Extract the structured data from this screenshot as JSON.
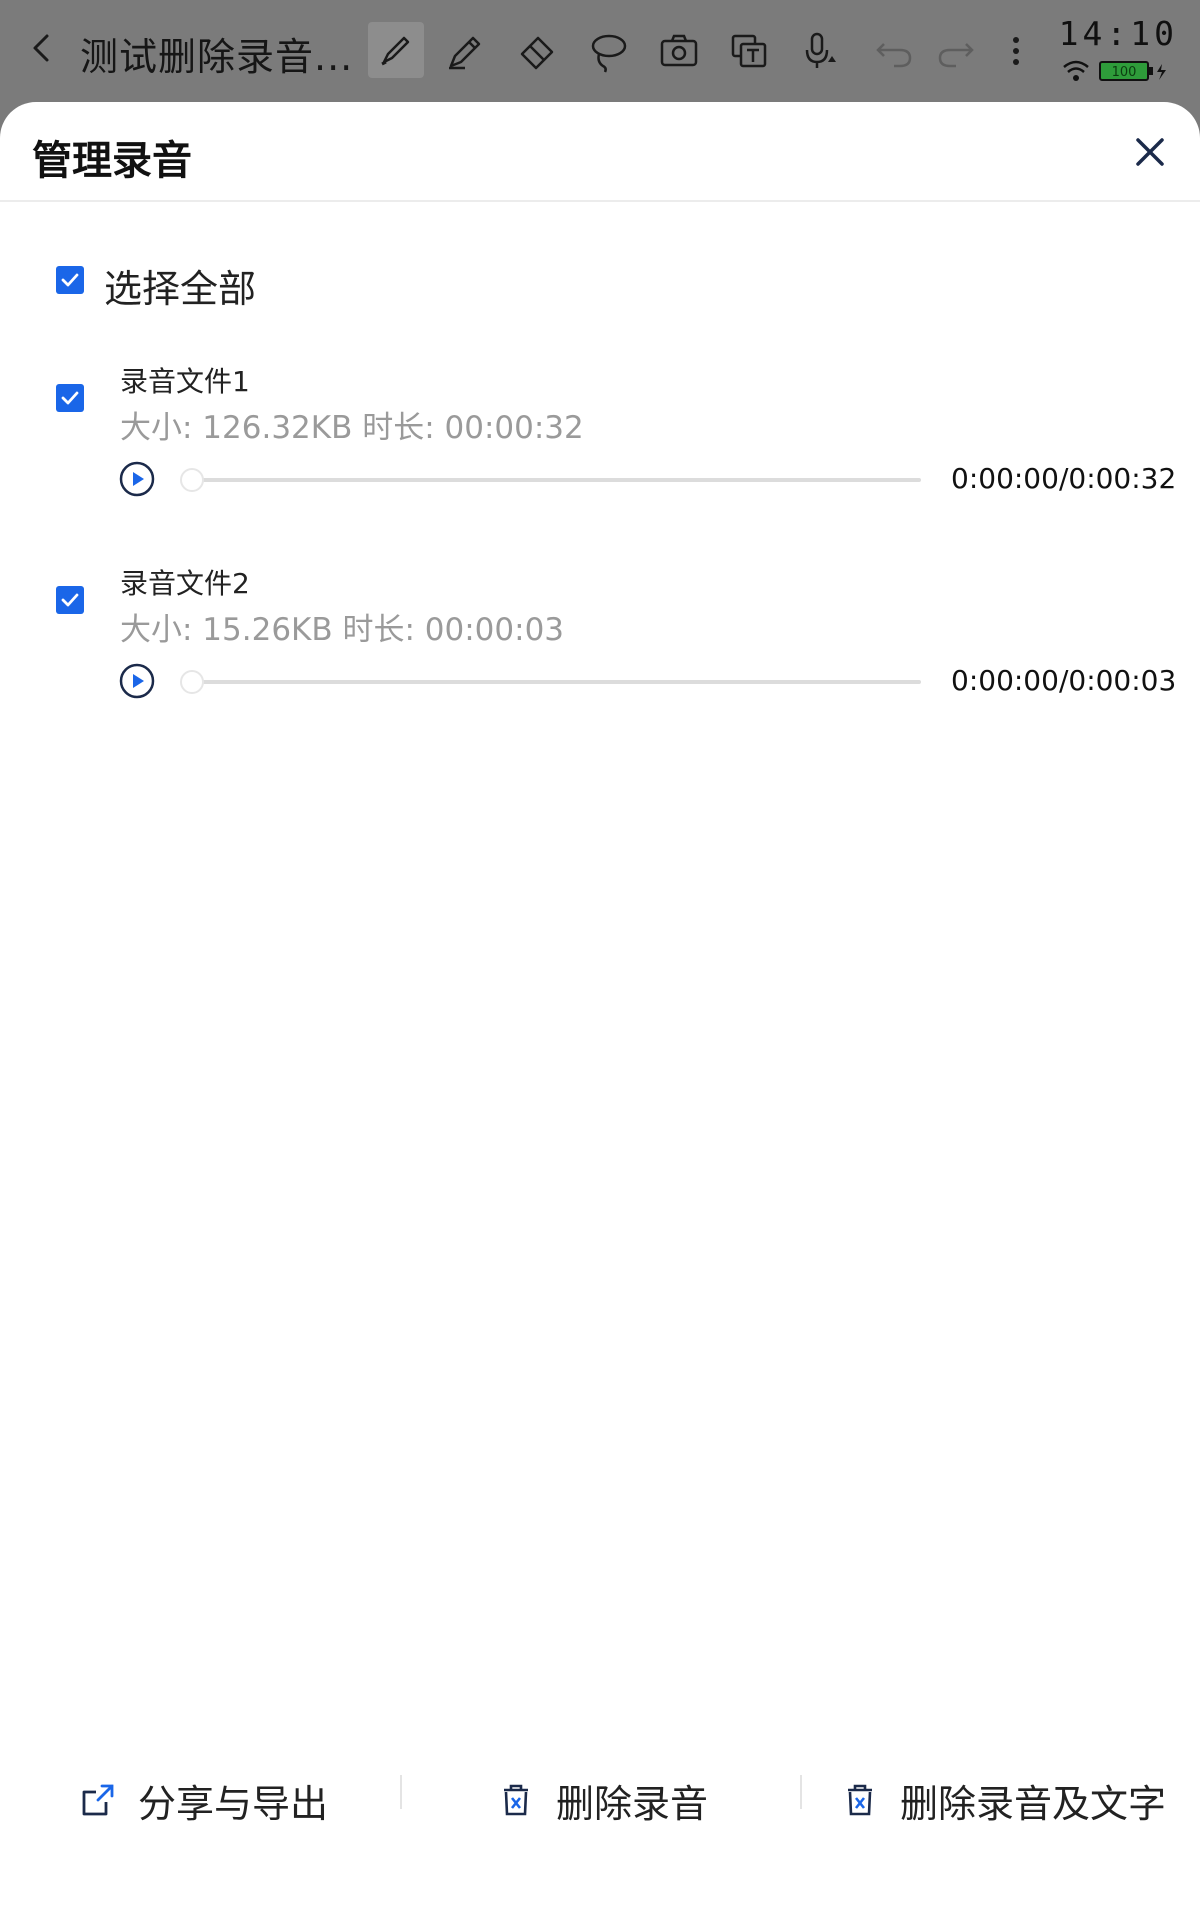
{
  "toolbar": {
    "doc_title": "测试删除录音...",
    "tools": [
      "brush-icon",
      "pen-icon",
      "eraser-icon",
      "lasso-icon",
      "camera-icon",
      "text-recognition-icon",
      "microphone-icon",
      "undo-icon",
      "redo-icon",
      "more-icon"
    ],
    "clock": "14:10",
    "battery": "100"
  },
  "sheet": {
    "title": "管理录音",
    "select_all": {
      "label": "选择全部",
      "checked": true
    },
    "recordings": [
      {
        "name": "录音文件1",
        "meta": "大小: 126.32KB   时长: 00:00:32",
        "time": "0:00:00/0:00:32",
        "checked": true,
        "progress": 0
      },
      {
        "name": "录音文件2",
        "meta": "大小: 15.26KB   时长: 00:00:03",
        "time": "0:00:00/0:00:03",
        "checked": true,
        "progress": 0
      }
    ],
    "actions": {
      "share": "分享与导出",
      "delete_audio": "删除录音",
      "delete_audio_text": "删除录音及文字"
    }
  },
  "colors": {
    "accent": "#1a66e8",
    "meta_text": "#9a9a9a",
    "toolbar_bg": "#7b7b7b"
  }
}
